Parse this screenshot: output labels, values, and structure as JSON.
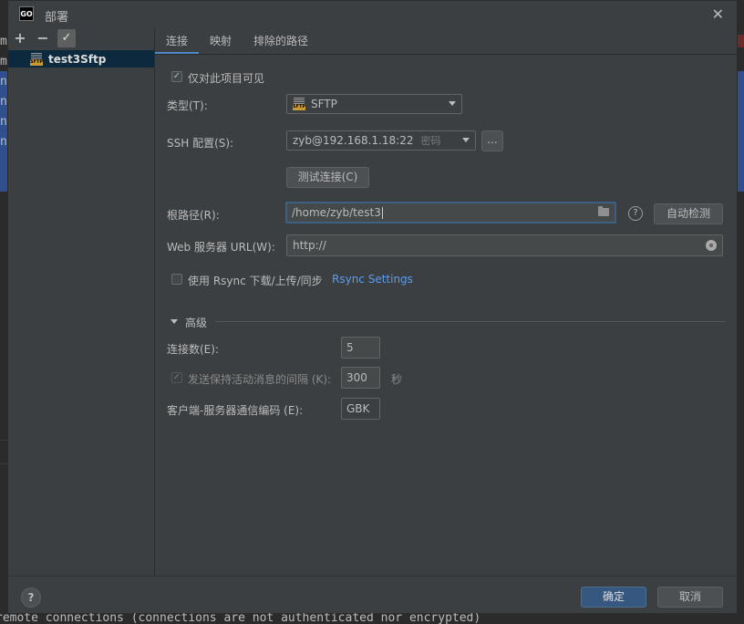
{
  "background": {
    "letters": [
      "m",
      "m",
      "n",
      "n",
      "n",
      "n"
    ],
    "bottom_line": "remote connections (connections are not authenticated nor encrypted)"
  },
  "dialog": {
    "app_icon": "GO",
    "title": "部署",
    "close": "✕"
  },
  "toolbar": {
    "add": "+",
    "remove": "−",
    "check": "✓"
  },
  "servers": [
    {
      "name": "test3Sftp",
      "icon": "sftp-icon"
    }
  ],
  "tabs": [
    "连接",
    "映射",
    "排除的路径"
  ],
  "connection": {
    "visible_only_label": "仅对此项目可见",
    "visible_only_checked": true,
    "type_label": "类型(T):",
    "type_value": "SFTP",
    "ssh_label": "SSH 配置(S):",
    "ssh_value": "zyb@192.168.1.18:22",
    "ssh_hint": "密码",
    "ssh_more": "...",
    "test_button": "测试连接(C)",
    "root_label": "根路径(R):",
    "root_value": "/home/zyb/test3",
    "autodetect_button": "自动检测",
    "help": "?",
    "web_url_label": "Web 服务器 URL(W):",
    "web_url_value": "http://",
    "rsync_label": "使用 Rsync 下载/上传/同步",
    "rsync_checked": false,
    "rsync_link": "Rsync Settings"
  },
  "advanced": {
    "header": "高级",
    "connections_label": "连接数(E):",
    "connections_value": "5",
    "keepalive_label": "发送保持活动消息的间隔 (K):",
    "keepalive_value": "300",
    "keepalive_unit": "秒",
    "encoding_label": "客户端-服务器通信编码 (E):",
    "encoding_value": "GBK"
  },
  "footer": {
    "help": "?",
    "ok": "确定",
    "cancel": "取消"
  }
}
